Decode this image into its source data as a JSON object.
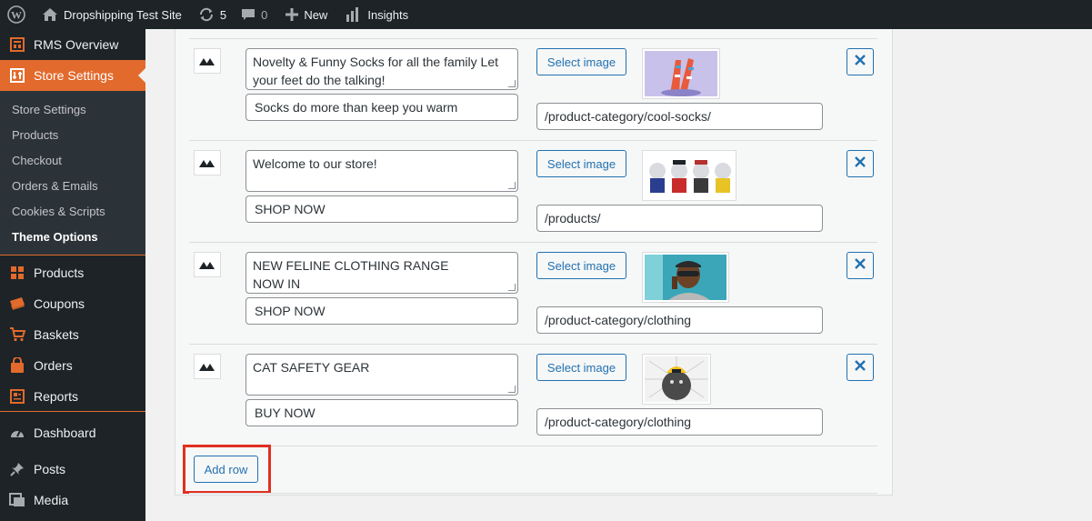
{
  "admin_bar": {
    "site_name": "Dropshipping Test Site",
    "updates_count": "5",
    "comments_count": "0",
    "new_label": "New",
    "insights_label": "Insights"
  },
  "sidebar": {
    "rms_overview": "RMS Overview",
    "store_settings": "Store Settings",
    "submenu": [
      "Store Settings",
      "Products",
      "Checkout",
      "Orders & Emails",
      "Cookies & Scripts",
      "Theme Options"
    ],
    "items": [
      "Products",
      "Coupons",
      "Baskets",
      "Orders",
      "Reports"
    ],
    "wp_items": [
      "Dashboard",
      "Posts",
      "Media"
    ]
  },
  "rows": [
    {
      "text": "Novelty & Funny Socks for all the family Let your feet do the talking!",
      "button_text": "Socks do more than keep you warm",
      "select_label": "Select image",
      "url": "/product-category/cool-socks/"
    },
    {
      "text": "Welcome to our store!",
      "button_text": "SHOP NOW",
      "select_label": "Select image",
      "url": "/products/"
    },
    {
      "text": "NEW FELINE CLOTHING RANGE\nNOW IN",
      "button_text": "SHOP NOW",
      "select_label": "Select image",
      "url": "/product-category/clothing"
    },
    {
      "text": "CAT SAFETY GEAR",
      "button_text": "BUY NOW",
      "select_label": "Select image",
      "url": "/product-category/clothing"
    }
  ],
  "add_row_label": "Add row",
  "colors": {
    "accent": "#e26a2c",
    "link": "#2271b1",
    "admin_dark": "#1d2327",
    "highlight": "#e03021"
  }
}
